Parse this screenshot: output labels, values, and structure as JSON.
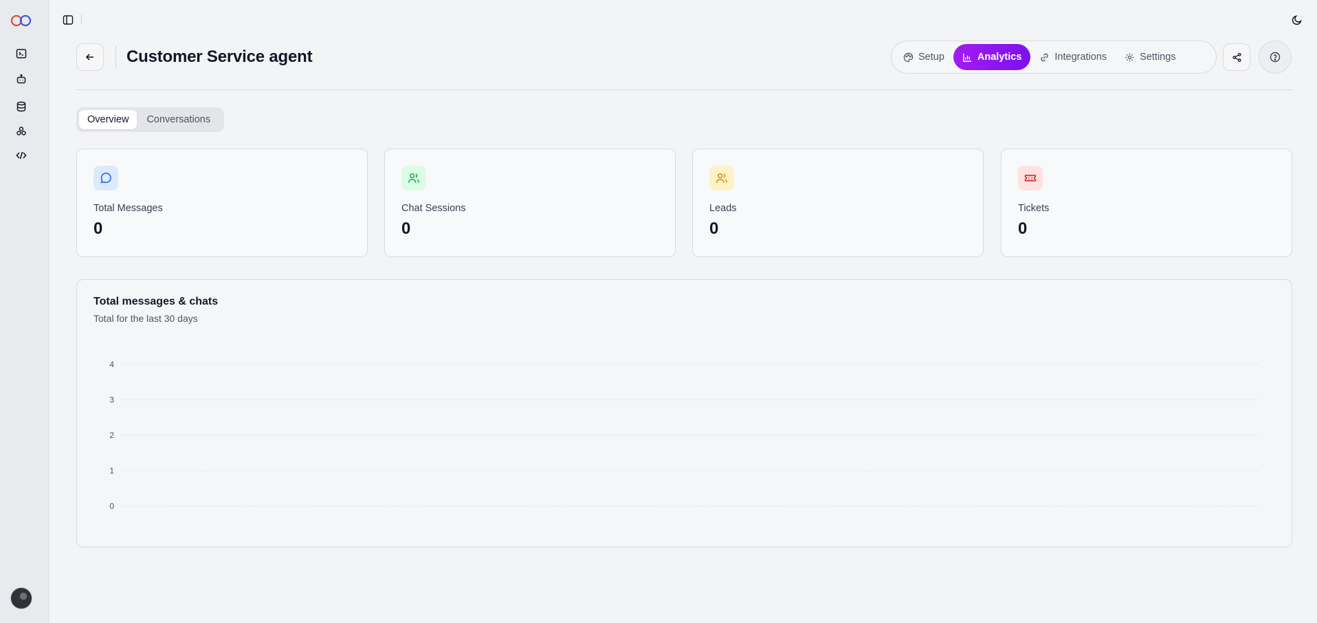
{
  "sidebar": {
    "logo": "infinity-logo",
    "items": [
      {
        "name": "terminal-icon"
      },
      {
        "name": "bot-icon"
      },
      {
        "name": "database-icon"
      },
      {
        "name": "integrations-icon"
      },
      {
        "name": "code-icon"
      }
    ],
    "avatar": "user-avatar"
  },
  "header": {
    "title": "Customer Service agent",
    "tabs": [
      {
        "label": "Setup",
        "icon": "palette-icon",
        "active": false
      },
      {
        "label": "Analytics",
        "icon": "chart-icon",
        "active": true
      },
      {
        "label": "Integrations",
        "icon": "link-icon",
        "active": false
      },
      {
        "label": "Settings",
        "icon": "gear-icon",
        "active": false
      }
    ],
    "accent_gradient": [
      "#a21cf0",
      "#7c10f0"
    ]
  },
  "subtabs": [
    {
      "label": "Overview",
      "active": true
    },
    {
      "label": "Conversations",
      "active": false
    }
  ],
  "stats": [
    {
      "label": "Total Messages",
      "value": "0",
      "icon": "message-circle-icon",
      "color": "#2563eb",
      "bg": "#dbeafe"
    },
    {
      "label": "Chat Sessions",
      "value": "0",
      "icon": "users-icon",
      "color": "#16a34a",
      "bg": "#dcfce7"
    },
    {
      "label": "Leads",
      "value": "0",
      "icon": "users-icon",
      "color": "#ca8a04",
      "bg": "#fef3c7"
    },
    {
      "label": "Tickets",
      "value": "0",
      "icon": "ticket-icon",
      "color": "#dc2626",
      "bg": "#fee2e2"
    }
  ],
  "chart": {
    "title": "Total messages & chats",
    "subtitle": "Total for the last 30 days"
  },
  "chart_data": {
    "type": "line",
    "title": "Total messages & chats",
    "subtitle": "Total for the last 30 days",
    "ylim": [
      0,
      4
    ],
    "y_ticks": [
      "0",
      "1",
      "2",
      "3",
      "4"
    ],
    "grid": true,
    "series": []
  }
}
